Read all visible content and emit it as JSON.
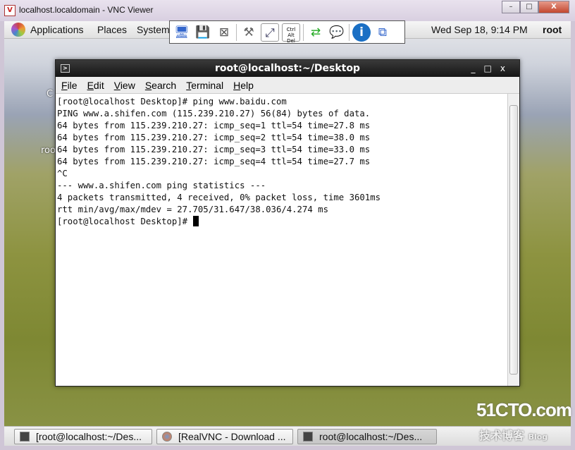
{
  "vnc": {
    "title": "localhost.localdomain - VNC Viewer",
    "logo": "V2",
    "buttons": {
      "minimize": "–",
      "maximize": "□",
      "close": "X"
    }
  },
  "panel": {
    "menus": [
      "Applications",
      "Places",
      "System"
    ],
    "clock": "Wed Sep 18,  9:14 PM",
    "user": "root"
  },
  "toolbar": {
    "icons": [
      "new-connection-icon",
      "save-icon",
      "close-connection-icon",
      "options-icon",
      "fullscreen-icon",
      "ctrl-alt-del-icon",
      "transfer-files-icon",
      "chat-icon",
      "info-icon",
      "connections-icon"
    ]
  },
  "desktop": {
    "icon_labels": [
      "C",
      "roo"
    ]
  },
  "terminal": {
    "title": "root@localhost:~/Desktop",
    "menu": [
      {
        "u": "F",
        "rest": "ile"
      },
      {
        "u": "E",
        "rest": "dit"
      },
      {
        "u": "V",
        "rest": "iew"
      },
      {
        "u": "S",
        "rest": "earch"
      },
      {
        "u": "T",
        "rest": "erminal"
      },
      {
        "u": "H",
        "rest": "elp"
      }
    ],
    "lines": [
      "[root@localhost Desktop]# ping www.baidu.com",
      "PING www.a.shifen.com (115.239.210.27) 56(84) bytes of data.",
      "64 bytes from 115.239.210.27: icmp_seq=1 ttl=54 time=27.8 ms",
      "64 bytes from 115.239.210.27: icmp_seq=2 ttl=54 time=38.0 ms",
      "64 bytes from 115.239.210.27: icmp_seq=3 ttl=54 time=33.0 ms",
      "64 bytes from 115.239.210.27: icmp_seq=4 ttl=54 time=27.7 ms",
      "^C",
      "--- www.a.shifen.com ping statistics ---",
      "4 packets transmitted, 4 received, 0% packet loss, time 3601ms",
      "rtt min/avg/max/mdev = 27.705/31.647/38.036/4.274 ms"
    ],
    "prompt": "[root@localhost Desktop]# "
  },
  "taskbar": [
    "[root@localhost:~/Des...",
    "[RealVNC - Download ...",
    "root@localhost:~/Des..."
  ],
  "watermark": {
    "line1": "51CTO.com",
    "line2": "技术博客",
    "line3": "Blog"
  }
}
